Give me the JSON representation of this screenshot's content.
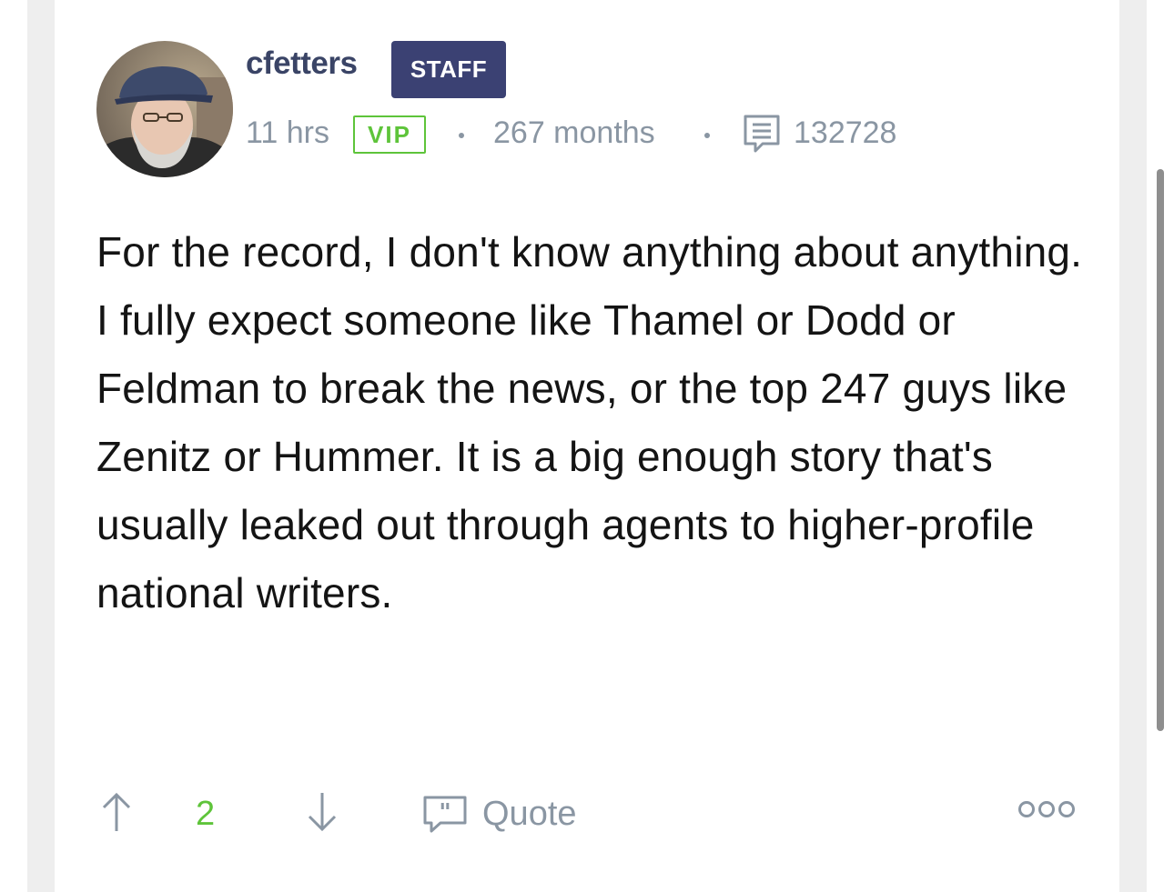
{
  "post": {
    "author": {
      "username": "cfetters",
      "role_badge": "STAFF",
      "avatar_alt": "user-avatar-photo"
    },
    "meta": {
      "posted_ago": "11 hrs",
      "membership_badge": "VIP",
      "member_duration": "267 months",
      "post_count": "132728"
    },
    "body": "For the record, I don't know anything about anything. I fully expect someone like Thamel or Dodd or Feldman to break the news, or the top 247 guys like Zenitz or Hummer. It is a big enough story that's usually leaked out through agents to higher-profile national writers.",
    "actions": {
      "vote_count": "2",
      "quote_label": "Quote"
    }
  },
  "icons": {
    "upvote": "arrow-up-icon",
    "downvote": "arrow-down-icon",
    "posts": "message-icon",
    "quote": "quote-bubble-icon",
    "more": "more-options-icon"
  },
  "colors": {
    "staff_badge_bg": "#3b4173",
    "username": "#3a4466",
    "vip_green": "#5ec43a",
    "meta_gray": "#8a96a3",
    "body_text": "#141414"
  }
}
